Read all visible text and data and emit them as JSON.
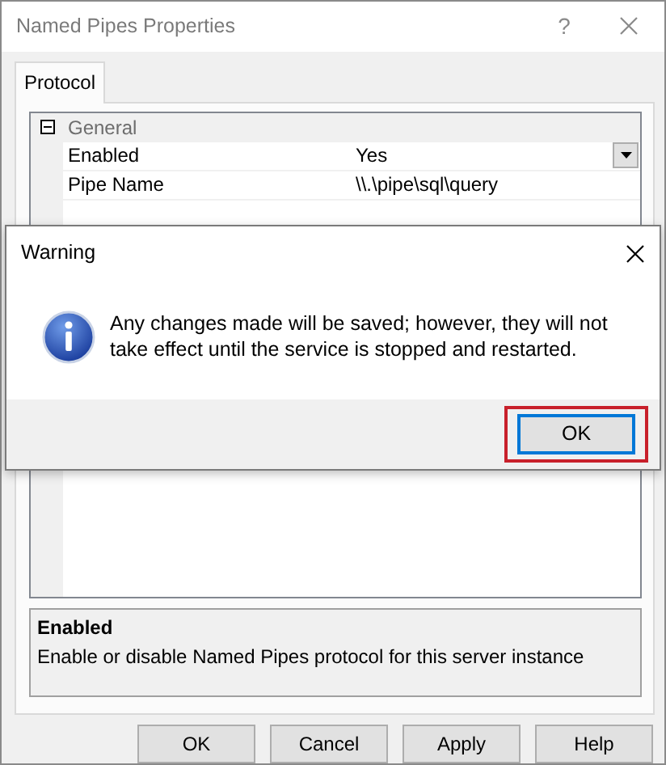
{
  "window": {
    "title": "Named Pipes Properties",
    "help_glyph": "?"
  },
  "tabs": [
    {
      "label": "Protocol",
      "selected": true
    }
  ],
  "property_grid": {
    "categories": [
      {
        "label": "General",
        "expanded": true,
        "properties": [
          {
            "name": "Enabled",
            "value": "Yes",
            "kind": "dropdown"
          },
          {
            "name": "Pipe Name",
            "value": "\\\\.\\pipe\\sql\\query",
            "kind": "text"
          }
        ]
      }
    ]
  },
  "description": {
    "title": "Enabled",
    "text": "Enable or disable Named Pipes protocol for this server instance"
  },
  "buttons": [
    {
      "label": "OK"
    },
    {
      "label": "Cancel"
    },
    {
      "label": "Apply"
    },
    {
      "label": "Help"
    }
  ],
  "warning_dialog": {
    "title": "Warning",
    "message": "Any changes made will be saved; however, they will not take effect until the service is stopped and restarted.",
    "buttons": [
      {
        "label": "OK",
        "highlighted": true
      }
    ]
  }
}
